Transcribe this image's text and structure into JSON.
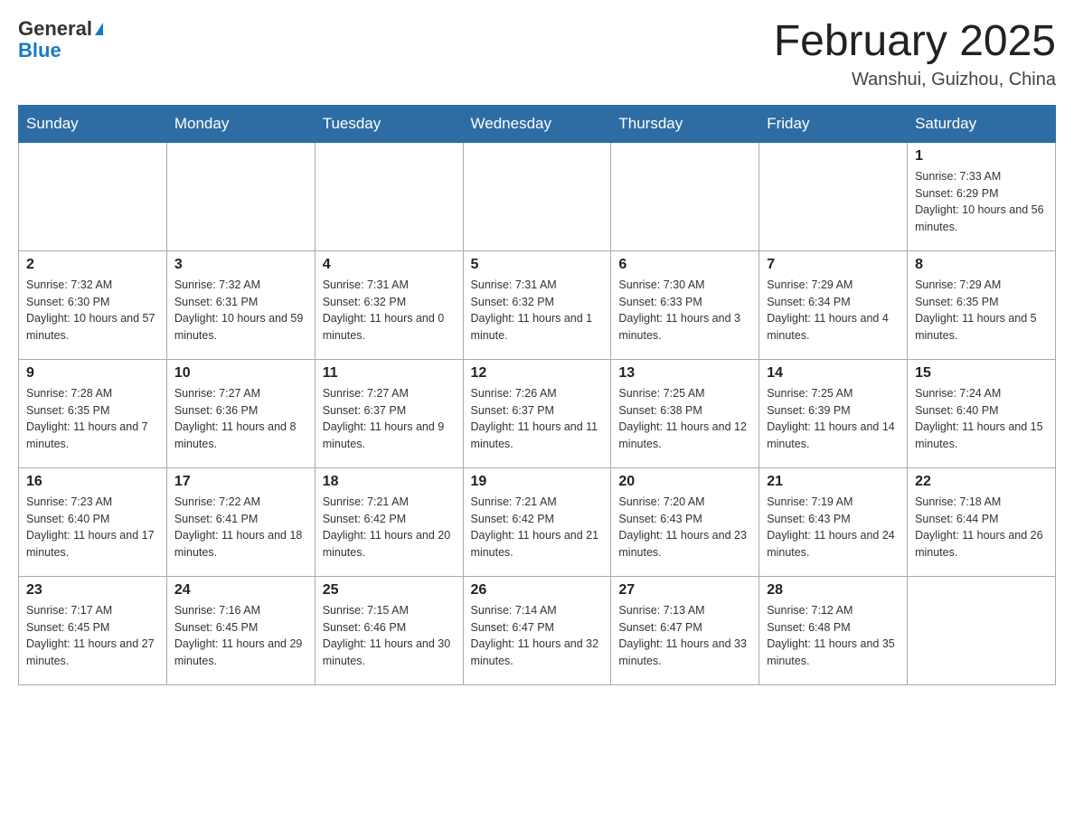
{
  "logo": {
    "general": "General",
    "blue": "Blue"
  },
  "title": "February 2025",
  "subtitle": "Wanshui, Guizhou, China",
  "days_of_week": [
    "Sunday",
    "Monday",
    "Tuesday",
    "Wednesday",
    "Thursday",
    "Friday",
    "Saturday"
  ],
  "weeks": [
    [
      {
        "day": "",
        "info": ""
      },
      {
        "day": "",
        "info": ""
      },
      {
        "day": "",
        "info": ""
      },
      {
        "day": "",
        "info": ""
      },
      {
        "day": "",
        "info": ""
      },
      {
        "day": "",
        "info": ""
      },
      {
        "day": "1",
        "info": "Sunrise: 7:33 AM\nSunset: 6:29 PM\nDaylight: 10 hours and 56 minutes."
      }
    ],
    [
      {
        "day": "2",
        "info": "Sunrise: 7:32 AM\nSunset: 6:30 PM\nDaylight: 10 hours and 57 minutes."
      },
      {
        "day": "3",
        "info": "Sunrise: 7:32 AM\nSunset: 6:31 PM\nDaylight: 10 hours and 59 minutes."
      },
      {
        "day": "4",
        "info": "Sunrise: 7:31 AM\nSunset: 6:32 PM\nDaylight: 11 hours and 0 minutes."
      },
      {
        "day": "5",
        "info": "Sunrise: 7:31 AM\nSunset: 6:32 PM\nDaylight: 11 hours and 1 minute."
      },
      {
        "day": "6",
        "info": "Sunrise: 7:30 AM\nSunset: 6:33 PM\nDaylight: 11 hours and 3 minutes."
      },
      {
        "day": "7",
        "info": "Sunrise: 7:29 AM\nSunset: 6:34 PM\nDaylight: 11 hours and 4 minutes."
      },
      {
        "day": "8",
        "info": "Sunrise: 7:29 AM\nSunset: 6:35 PM\nDaylight: 11 hours and 5 minutes."
      }
    ],
    [
      {
        "day": "9",
        "info": "Sunrise: 7:28 AM\nSunset: 6:35 PM\nDaylight: 11 hours and 7 minutes."
      },
      {
        "day": "10",
        "info": "Sunrise: 7:27 AM\nSunset: 6:36 PM\nDaylight: 11 hours and 8 minutes."
      },
      {
        "day": "11",
        "info": "Sunrise: 7:27 AM\nSunset: 6:37 PM\nDaylight: 11 hours and 9 minutes."
      },
      {
        "day": "12",
        "info": "Sunrise: 7:26 AM\nSunset: 6:37 PM\nDaylight: 11 hours and 11 minutes."
      },
      {
        "day": "13",
        "info": "Sunrise: 7:25 AM\nSunset: 6:38 PM\nDaylight: 11 hours and 12 minutes."
      },
      {
        "day": "14",
        "info": "Sunrise: 7:25 AM\nSunset: 6:39 PM\nDaylight: 11 hours and 14 minutes."
      },
      {
        "day": "15",
        "info": "Sunrise: 7:24 AM\nSunset: 6:40 PM\nDaylight: 11 hours and 15 minutes."
      }
    ],
    [
      {
        "day": "16",
        "info": "Sunrise: 7:23 AM\nSunset: 6:40 PM\nDaylight: 11 hours and 17 minutes."
      },
      {
        "day": "17",
        "info": "Sunrise: 7:22 AM\nSunset: 6:41 PM\nDaylight: 11 hours and 18 minutes."
      },
      {
        "day": "18",
        "info": "Sunrise: 7:21 AM\nSunset: 6:42 PM\nDaylight: 11 hours and 20 minutes."
      },
      {
        "day": "19",
        "info": "Sunrise: 7:21 AM\nSunset: 6:42 PM\nDaylight: 11 hours and 21 minutes."
      },
      {
        "day": "20",
        "info": "Sunrise: 7:20 AM\nSunset: 6:43 PM\nDaylight: 11 hours and 23 minutes."
      },
      {
        "day": "21",
        "info": "Sunrise: 7:19 AM\nSunset: 6:43 PM\nDaylight: 11 hours and 24 minutes."
      },
      {
        "day": "22",
        "info": "Sunrise: 7:18 AM\nSunset: 6:44 PM\nDaylight: 11 hours and 26 minutes."
      }
    ],
    [
      {
        "day": "23",
        "info": "Sunrise: 7:17 AM\nSunset: 6:45 PM\nDaylight: 11 hours and 27 minutes."
      },
      {
        "day": "24",
        "info": "Sunrise: 7:16 AM\nSunset: 6:45 PM\nDaylight: 11 hours and 29 minutes."
      },
      {
        "day": "25",
        "info": "Sunrise: 7:15 AM\nSunset: 6:46 PM\nDaylight: 11 hours and 30 minutes."
      },
      {
        "day": "26",
        "info": "Sunrise: 7:14 AM\nSunset: 6:47 PM\nDaylight: 11 hours and 32 minutes."
      },
      {
        "day": "27",
        "info": "Sunrise: 7:13 AM\nSunset: 6:47 PM\nDaylight: 11 hours and 33 minutes."
      },
      {
        "day": "28",
        "info": "Sunrise: 7:12 AM\nSunset: 6:48 PM\nDaylight: 11 hours and 35 minutes."
      },
      {
        "day": "",
        "info": ""
      }
    ]
  ]
}
